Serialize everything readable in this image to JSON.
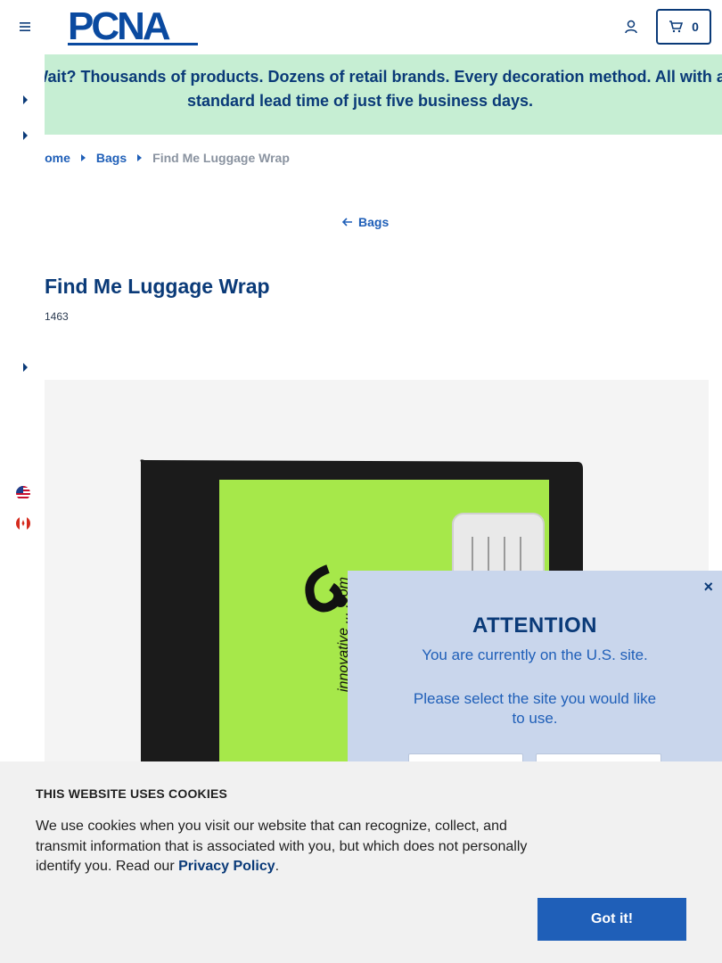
{
  "header": {
    "logo_text": "PCNA",
    "cart_count": "0"
  },
  "promo": {
    "text": "Why Wait? Thousands of products. Dozens of retail brands. Every decoration method. All with a standard lead time of just five business days."
  },
  "breadcrumb": {
    "home": "Home",
    "category": "Bags",
    "current": "Find Me Luggage Wrap"
  },
  "back_link": {
    "label": "Bags"
  },
  "product": {
    "title": "Find Me Luggage Wrap",
    "sku": "1463",
    "print_text": "innovative ... .com"
  },
  "modal": {
    "title": "ATTENTION",
    "line1": "You are currently on the U.S. site.",
    "line2": "Please select the site you would like to use.",
    "close": "×"
  },
  "cookie": {
    "title": "THIS WEBSITE USES COOKIES",
    "text": "We use cookies when you visit our website that can recognize, collect, and transmit information that is associated with you, but which does not personally identify you. Read our ",
    "link": "Privacy Policy",
    "period": ".",
    "button": "Got it!"
  },
  "rail": {
    "tab_label": "G"
  },
  "colors": {
    "brand": "#0a3a78",
    "link": "#1f5fb8",
    "promo_bg": "#c6eed3",
    "modal_bg": "#c9d6ec",
    "product_green": "#a6e84a"
  },
  "icons": [
    "hamburger-icon",
    "account-icon",
    "cart-icon",
    "us-flag-icon",
    "canada-flag-icon",
    "back-arrow-icon",
    "close-icon"
  ]
}
